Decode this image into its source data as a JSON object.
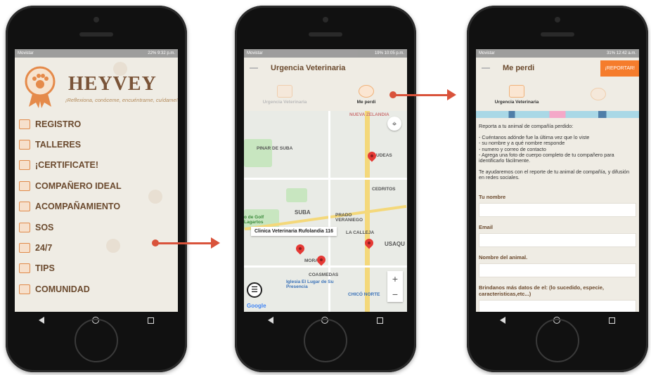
{
  "status": {
    "phone1": {
      "carrier": "Movistar",
      "right": "22% 9:32 p.m."
    },
    "phone2": {
      "carrier": "Movistar",
      "right": "19% 10:05 p.m."
    },
    "phone3": {
      "carrier": "Movistar",
      "right": "31% 12:42 a.m."
    }
  },
  "home": {
    "brand": "HEYVEY",
    "tagline": "¡Reflexiona, conóceme, encuéntrame, cuídame!",
    "menu": [
      {
        "label": "REGISTRO",
        "icon": "registro-icon"
      },
      {
        "label": "TALLERES",
        "icon": "talleres-icon"
      },
      {
        "label": "¡CERTIFICATE!",
        "icon": "certificate-icon"
      },
      {
        "label": "COMPAÑERO IDEAL",
        "icon": "companero-icon"
      },
      {
        "label": "ACOMPAÑAMIENTO",
        "icon": "acompanamiento-icon"
      },
      {
        "label": "SOS",
        "icon": "sos-icon"
      },
      {
        "label": "24/7",
        "icon": "24-7-icon"
      },
      {
        "label": "TIPS",
        "icon": "tips-icon"
      },
      {
        "label": "COMUNIDAD",
        "icon": "comunidad-icon"
      }
    ]
  },
  "map_screen": {
    "title": "Urgencia Veterinaria",
    "tabs": [
      {
        "label": "Urgencia Veterinaria",
        "active": false
      },
      {
        "label": "Me perdi",
        "active": true
      }
    ],
    "map_labels": [
      "NUEVA ZELANDIA",
      "PINAR DE SUBA",
      "SUBA",
      "PRADO VERANIEGO",
      "CEDRITOS",
      "LA CALLEJA",
      "USAQU",
      "COASMEDAS",
      "Iglesia El Lugar de Su Presencia",
      "CHICÓ NORTE",
      "o de Golf Lagartos",
      "UDEAS",
      "MORATO"
    ],
    "tooltip": "Clinica Veterinaria Rufolandia 116",
    "zoom_in": "+",
    "zoom_out": "−",
    "google": "Google"
  },
  "report_screen": {
    "title": "Me perdi",
    "report_button": "¡REPORTAR!",
    "tabs": [
      {
        "label": "Urgencia Veterinaria",
        "active": true
      },
      {
        "label": "",
        "active": false
      }
    ],
    "intro_lines": [
      "Reporta a tu animal de compañía perdido:",
      "- Cuéntanos adónde fue la última vez que lo viste\n- su nombre y a qué nombre responde\n- numero y correo de contacto\n- Agrega una foto de cuerpo completo de tu compañero para identificarlo fácilmente.",
      "Te ayudaremos con el reporte de tu animal de compañía, y difusión en redes sociales."
    ],
    "fields": [
      {
        "label": "Tu nombre"
      },
      {
        "label": "Email"
      },
      {
        "label": "Nombre del animal."
      },
      {
        "label": "Brindanos más datos de el: (lo sucedido, especie, caracteristicas,etc...)"
      }
    ]
  },
  "colors": {
    "accent": "#f57c2c",
    "arrow": "#d9533b",
    "text_brown": "#6b4a2e"
  }
}
